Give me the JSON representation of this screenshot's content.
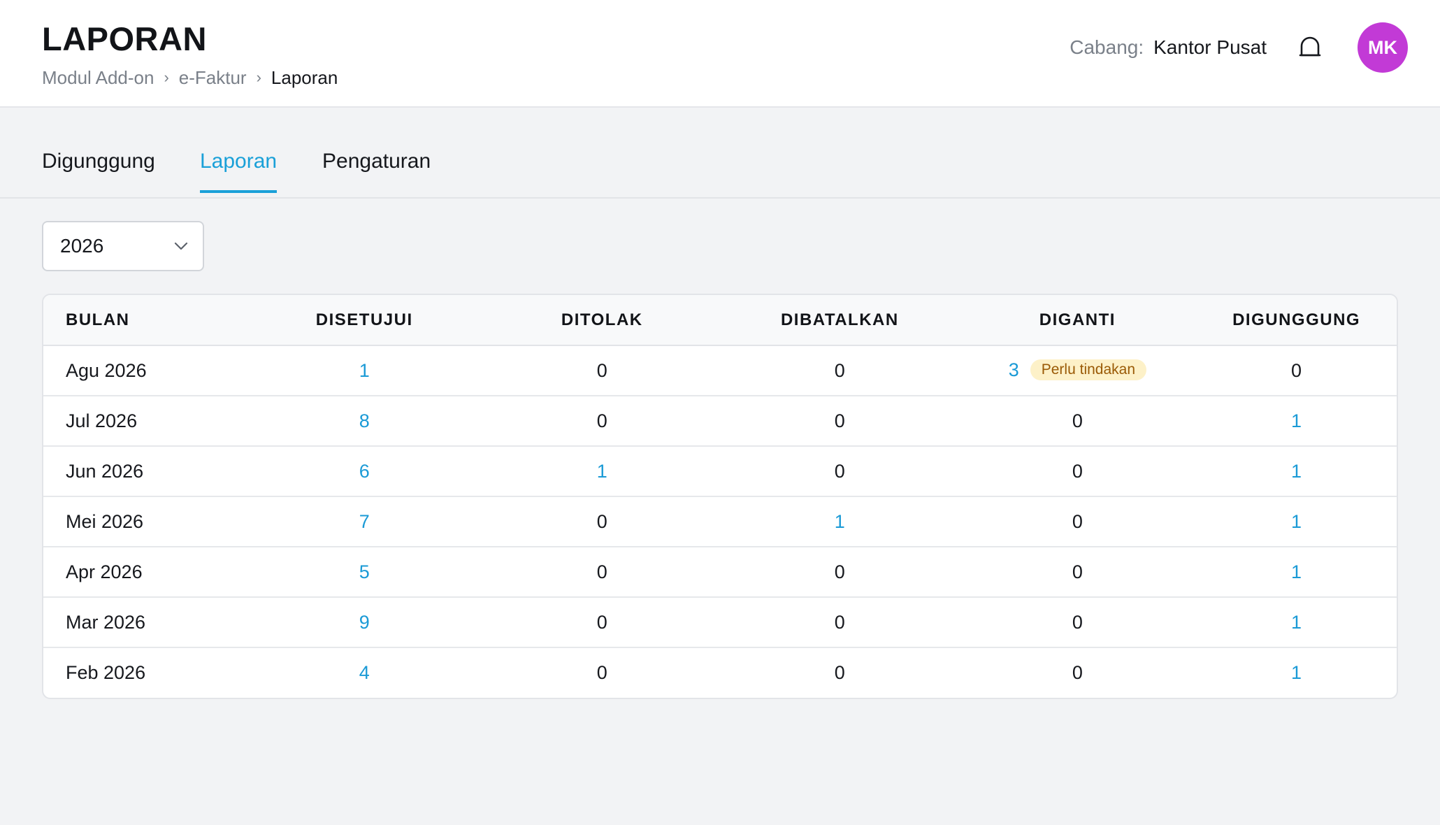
{
  "header": {
    "title": "LAPORAN",
    "breadcrumb": [
      "Modul Add-on",
      "e-Faktur",
      "Laporan"
    ],
    "branch_label": "Cabang:",
    "branch_value": "Kantor Pusat",
    "avatar_initials": "MK",
    "avatar_color": "#c23ad6",
    "bell_icon": "bell-icon"
  },
  "tabs": [
    {
      "label": "Digunggung",
      "active": false
    },
    {
      "label": "Laporan",
      "active": true
    },
    {
      "label": "Pengaturan",
      "active": false
    }
  ],
  "year_select": {
    "value": "2026",
    "icon": "chevron-down-icon"
  },
  "table": {
    "columns": [
      "BULAN",
      "DISETUJUI",
      "DITOLAK",
      "DIBATALKAN",
      "DIGANTI",
      "DIGUNGGUNG"
    ],
    "rows": [
      {
        "month": "Agu 2026",
        "cells": [
          "1",
          "0",
          "0",
          "3",
          "0"
        ],
        "links": [
          true,
          false,
          false,
          true,
          false
        ],
        "badge": "Perlu tindakan"
      },
      {
        "month": "Jul 2026",
        "cells": [
          "8",
          "0",
          "0",
          "0",
          "1"
        ],
        "links": [
          true,
          false,
          false,
          false,
          true
        ]
      },
      {
        "month": "Jun 2026",
        "cells": [
          "6",
          "1",
          "0",
          "0",
          "1"
        ],
        "links": [
          true,
          true,
          false,
          false,
          true
        ]
      },
      {
        "month": "Mei 2026",
        "cells": [
          "7",
          "0",
          "1",
          "0",
          "1"
        ],
        "links": [
          true,
          false,
          true,
          false,
          true
        ]
      },
      {
        "month": "Apr 2026",
        "cells": [
          "5",
          "0",
          "0",
          "0",
          "1"
        ],
        "links": [
          true,
          false,
          false,
          false,
          true
        ]
      },
      {
        "month": "Mar 2026",
        "cells": [
          "9",
          "0",
          "0",
          "0",
          "1"
        ],
        "links": [
          true,
          false,
          false,
          false,
          true
        ]
      },
      {
        "month": "Feb 2026",
        "cells": [
          "4",
          "0",
          "0",
          "0",
          "1"
        ],
        "links": [
          true,
          false,
          false,
          false,
          true
        ]
      }
    ]
  },
  "colors": {
    "accent": "#1aa0d8",
    "link": "#1a9ad6",
    "badge_bg": "#fdf1c8",
    "badge_text": "#9a5a06"
  }
}
